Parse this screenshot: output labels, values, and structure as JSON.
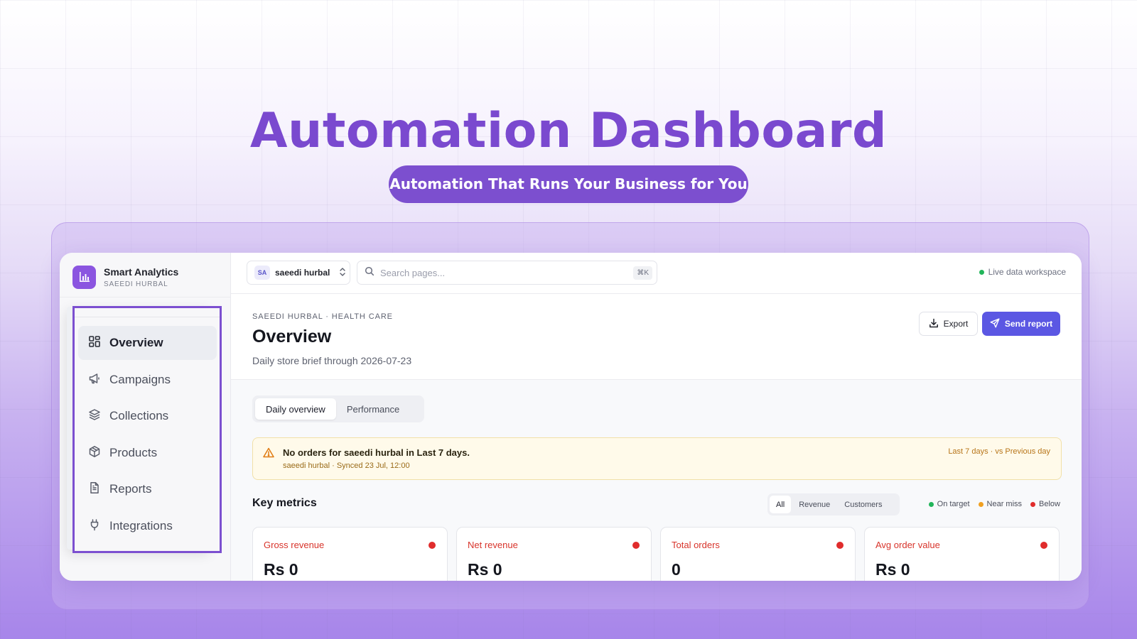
{
  "hero": {
    "title": "Automation Dashboard",
    "tagline": "Automation That Runs Your Business for You"
  },
  "colors": {
    "brand": "#7c4fcf",
    "primary_button": "#5b57e3",
    "status_on_target": "#22b55a",
    "status_near_miss": "#f0a021",
    "status_below": "#e02c2c"
  },
  "brand": {
    "name": "Smart Analytics",
    "subtitle": "SAEEDI HURBAL",
    "icon": "bar-chart-icon"
  },
  "sidebar": {
    "items": [
      {
        "label": "Overview",
        "icon": "grid-icon",
        "active": true
      },
      {
        "label": "Campaigns",
        "icon": "megaphone-icon",
        "active": false
      },
      {
        "label": "Collections",
        "icon": "layers-icon",
        "active": false
      },
      {
        "label": "Products",
        "icon": "box-icon",
        "active": false
      },
      {
        "label": "Reports",
        "icon": "document-icon",
        "active": false
      },
      {
        "label": "Integrations",
        "icon": "plug-icon",
        "active": false
      }
    ]
  },
  "topbar": {
    "workspace_initials": "SA",
    "workspace_name": "saeedi hurbal",
    "search_placeholder": "Search pages...",
    "search_shortcut": "⌘K",
    "live_label": "Live data workspace"
  },
  "header": {
    "breadcrumb": "SAEEDI HURBAL · HEALTH CARE",
    "title": "Overview",
    "description": "Daily store brief through 2026-07-23",
    "export_label": "Export",
    "send_label": "Send report"
  },
  "tabs": [
    "Daily overview",
    "Performance"
  ],
  "alert": {
    "title": "No orders for saeedi hurbal in Last 7 days.",
    "subtitle": "saeedi hurbal · Synced 23 Jul, 12:00",
    "range": "Last 7 days · vs Previous day"
  },
  "key_metrics": {
    "title": "Key metrics",
    "filters": [
      "All",
      "Revenue",
      "Customers"
    ],
    "legend": [
      "On target",
      "Near miss",
      "Below"
    ],
    "cards": [
      {
        "label": "Gross revenue",
        "value": "Rs 0",
        "status": "Below"
      },
      {
        "label": "Net revenue",
        "value": "Rs 0",
        "status": "Below"
      },
      {
        "label": "Total orders",
        "value": "0",
        "status": "Below"
      },
      {
        "label": "Avg order value",
        "value": "Rs 0",
        "status": "Below"
      }
    ]
  }
}
